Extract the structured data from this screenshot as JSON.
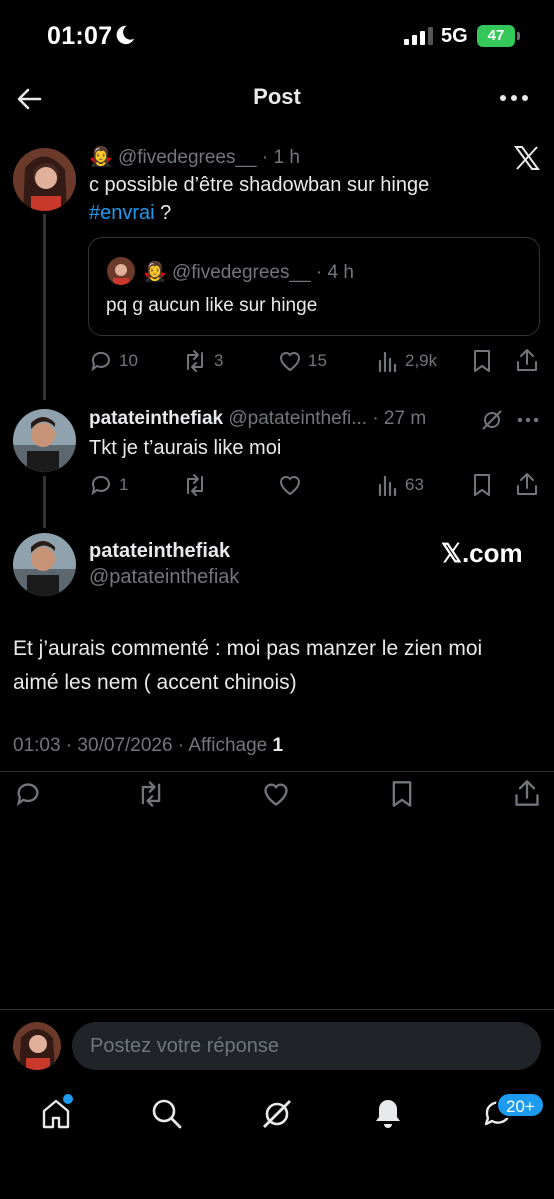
{
  "status_bar": {
    "time": "01:07",
    "network": "5G",
    "battery": "47"
  },
  "header": {
    "title": "Post"
  },
  "original_post": {
    "emoji": "🧛‍♀️",
    "handle": "@fivedegrees__",
    "time": "· 1 h",
    "text": "c possible d’être shadowban sur hinge",
    "hashtag": "#envrai",
    "text_after": " ?",
    "quote": {
      "emoji": "🧛‍♀️",
      "handle": "@fivedegrees__",
      "time": "· 4 h",
      "text": "pq g aucun like sur hinge"
    },
    "actions": {
      "replies": "10",
      "reposts": "3",
      "likes": "15",
      "views": "2,9k"
    }
  },
  "reply_post": {
    "name": "patateinthefiak",
    "handle": "@patateinthefi...",
    "time": "· 27 m",
    "text": "Tkt je t’aurais like moi",
    "actions": {
      "replies": "1",
      "views": "63"
    }
  },
  "main_post": {
    "name": "patateinthefiak",
    "handle": "@patateinthefiak",
    "watermark": "𝕏.com",
    "text": "Et j’aurais commenté : moi pas manzer le zien moi aimé les nem ( accent chinois)",
    "meta_prefix": "01:03 · 30/07/2026 · Affichage ",
    "views": "1"
  },
  "reply_bar": {
    "placeholder": "Postez votre réponse"
  },
  "bottom_nav": {
    "items": [
      "home-icon",
      "search-icon",
      "grok-icon",
      "notifications-icon",
      "messages-icon"
    ],
    "messages_badge": "20+"
  },
  "colors": {
    "accent": "#1d9bf0",
    "muted": "#71767b",
    "border": "#2f3336",
    "battery": "#34c759"
  }
}
